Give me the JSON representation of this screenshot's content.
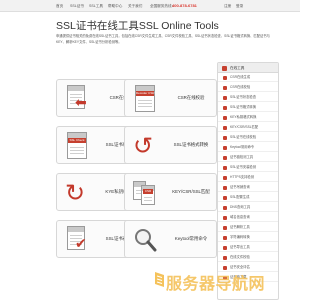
{
  "topnav": {
    "items": [
      "首页",
      "SSL证书",
      "SSL工具",
      "帮助中心",
      "关于我们"
    ],
    "hotline_label": "全国服务热线：",
    "phone": "400-878-6781",
    "links": [
      "注册",
      "登录"
    ]
  },
  "header": {
    "title": "SSL证书在线工具SSL Online Tools",
    "intro": "申通提供证书相关的免费在线SSL证书工具，包括在线CSR文件生成工具、CSR文件校验工具、SSL证书状态检查、SSL证书格式转换、匹配证书与KEY、解析KEY文件、SSL证书分析检测等。"
  },
  "tiles": [
    {
      "label": "CSR在线生成",
      "badge": ""
    },
    {
      "label": "CSR在线校验",
      "badge": "Decoder CSR"
    },
    {
      "label": "SSL证书状态检查",
      "badge": "SSL Check"
    },
    {
      "label": "SSL证书格式转换",
      "badge": ""
    },
    {
      "label": "KYE私钥格式转换",
      "badge": ""
    },
    {
      "label": "KEY/CSR/SSL匹配",
      "badge": "CSR"
    },
    {
      "label": "SSL证书在线校验",
      "badge": ""
    },
    {
      "label": "Keytool常用命令",
      "badge": ""
    }
  ],
  "sidebar": {
    "title": "在线工具",
    "items": [
      "CSR在线生成",
      "CSR在线校验",
      "SSL证书状态检查",
      "SSL证书格式转换",
      "KEY私钥格式转换",
      "KEY/CSR/SSL匹配",
      "SSL证书在线校验",
      "Keytool常用命令",
      "证书链检测工具",
      "SSL证书安装检测",
      "HTTPS支持检测",
      "证书吊销查询",
      "SSL配置生成",
      "DNS查询工具",
      "域名信息查询",
      "证书解析工具",
      "字符编码转换",
      "证书导出工具",
      "在线文件校验",
      "证书安全评估",
      "证书链下载"
    ]
  },
  "watermark": {
    "text": "服务器导航网",
    "brand_color": "#f5c25a"
  },
  "colors": {
    "accent": "#c6402f",
    "phone": "#d9342b"
  }
}
